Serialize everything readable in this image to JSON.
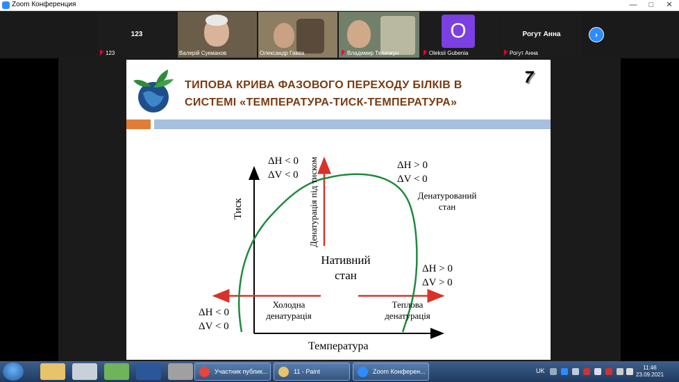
{
  "window": {
    "title": "Zoom Конференция",
    "minimize": "—",
    "maximize": "□",
    "close": "✕"
  },
  "participants": [
    {
      "name": "123",
      "label": "123"
    },
    {
      "name": "Валерій Сукманов"
    },
    {
      "name": "Олександр Гавва"
    },
    {
      "name": "Владимир Теличкун"
    },
    {
      "name": "Oleksii Gubenia",
      "initial": "O"
    },
    {
      "name": "Рогут Анна",
      "label": "Рогут Анна"
    }
  ],
  "next_page": "›",
  "slide": {
    "title_line1": "ТИПОВА  КРИВА ФАЗОВОГО ПЕРЕХОДУ  БІЛКІВ  В",
    "title_line2": "СИСТЕМІ  «ТЕМПЕРАТУРА-ТИСК-ТЕМПЕРАТУРА»",
    "number": "7",
    "diagram": {
      "y_axis": "Тиск",
      "x_axis": "Температура",
      "top_left_dh": "ΔH < 0",
      "top_left_dv": "ΔV < 0",
      "top_right_dh": "ΔH > 0",
      "top_right_dv": "ΔV < 0",
      "denatured_1": "Денатурований",
      "denatured_2": "стан",
      "pressure_denat": "Денатурація під тиском",
      "native_1": "Нативний",
      "native_2": "стан",
      "right_dh": "ΔH > 0",
      "right_dv": "ΔV > 0",
      "bottom_left_dh": "ΔH < 0",
      "bottom_left_dv": "ΔV < 0",
      "cold_1": "Холодна",
      "cold_2": "денатурація",
      "heat_1": "Теплова",
      "heat_2": "денатурація"
    }
  },
  "taskbar": {
    "tasks": [
      "Участник публик...",
      "11 - Paint",
      "Zoom Конферен..."
    ],
    "lang": "UK",
    "time": "11:46",
    "date": "23.09.2021"
  },
  "colors": {
    "zoom_blue": "#2d8cff",
    "title_brown": "#7a3b10",
    "curve_green": "#1d8a3c",
    "arrow_red": "#d9322a"
  }
}
